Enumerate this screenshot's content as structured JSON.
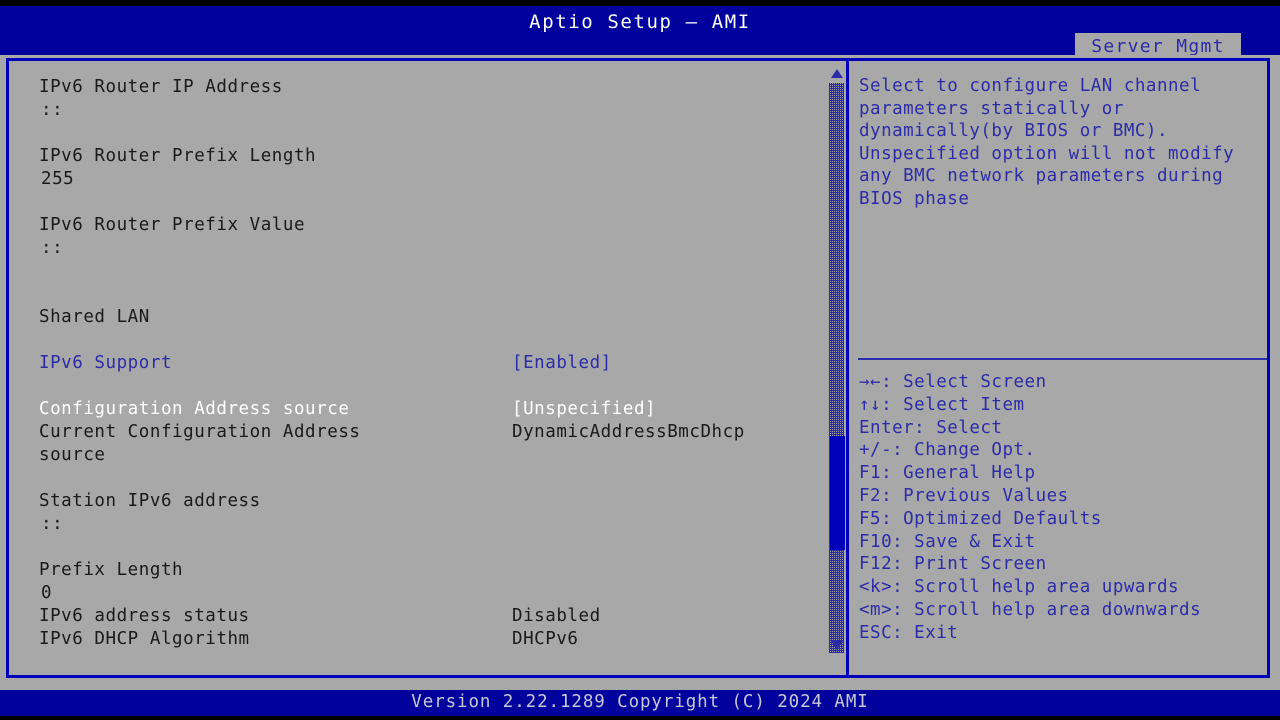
{
  "header": {
    "title": "Aptio Setup – AMI",
    "active_tab": "Server Mgmt"
  },
  "settings": {
    "rows": [
      {
        "label": "IPv6 Router IP Address",
        "value": "",
        "label_color": "dark",
        "value_color": "dark",
        "indent": false
      },
      {
        "label": "::",
        "value": "",
        "label_color": "dark",
        "value_color": "dark",
        "indent": true
      },
      {
        "label": "",
        "value": "",
        "label_color": "dark",
        "value_color": "dark",
        "indent": false
      },
      {
        "label": "IPv6 Router Prefix Length",
        "value": "",
        "label_color": "dark",
        "value_color": "dark",
        "indent": false
      },
      {
        "label": "255",
        "value": "",
        "label_color": "dark",
        "value_color": "dark",
        "indent": true
      },
      {
        "label": "",
        "value": "",
        "label_color": "dark",
        "value_color": "dark",
        "indent": false
      },
      {
        "label": "IPv6 Router Prefix Value",
        "value": "",
        "label_color": "dark",
        "value_color": "dark",
        "indent": false
      },
      {
        "label": "::",
        "value": "",
        "label_color": "dark",
        "value_color": "dark",
        "indent": true
      },
      {
        "label": "",
        "value": "",
        "label_color": "dark",
        "value_color": "dark",
        "indent": false
      },
      {
        "label": "",
        "value": "",
        "label_color": "dark",
        "value_color": "dark",
        "indent": false
      },
      {
        "label": "Shared LAN",
        "value": "",
        "label_color": "dark",
        "value_color": "dark",
        "indent": false
      },
      {
        "label": "",
        "value": "",
        "label_color": "dark",
        "value_color": "dark",
        "indent": false
      },
      {
        "label": "IPv6 Support",
        "value": "[Enabled]",
        "label_color": "blue",
        "value_color": "blue",
        "indent": false
      },
      {
        "label": "",
        "value": "",
        "label_color": "dark",
        "value_color": "dark",
        "indent": false
      },
      {
        "label": "Configuration Address source",
        "value": "[Unspecified]",
        "label_color": "white",
        "value_color": "white",
        "indent": false
      },
      {
        "label": "Current Configuration Address",
        "value": "DynamicAddressBmcDhcp",
        "label_color": "dark",
        "value_color": "dark",
        "indent": false
      },
      {
        "label": "source",
        "value": "",
        "label_color": "dark",
        "value_color": "dark",
        "indent": false
      },
      {
        "label": "",
        "value": "",
        "label_color": "dark",
        "value_color": "dark",
        "indent": false
      },
      {
        "label": "Station IPv6 address",
        "value": "",
        "label_color": "dark",
        "value_color": "dark",
        "indent": false
      },
      {
        "label": "::",
        "value": "",
        "label_color": "dark",
        "value_color": "dark",
        "indent": true
      },
      {
        "label": "",
        "value": "",
        "label_color": "dark",
        "value_color": "dark",
        "indent": false
      },
      {
        "label": "Prefix Length",
        "value": "",
        "label_color": "dark",
        "value_color": "dark",
        "indent": false
      },
      {
        "label": "0",
        "value": "",
        "label_color": "dark",
        "value_color": "dark",
        "indent": true
      },
      {
        "label": "IPv6 address status",
        "value": "Disabled",
        "label_color": "dark",
        "value_color": "dark",
        "indent": false
      },
      {
        "label": "IPv6 DHCP Algorithm",
        "value": "DHCPv6",
        "label_color": "dark",
        "value_color": "dark",
        "indent": false
      }
    ]
  },
  "scrollbar": {
    "up_arrow": "scroll-up-arrow",
    "down_arrow": "scroll-down-arrow",
    "thumb_top_pct": 62,
    "thumb_height_pct": 20
  },
  "help": {
    "description": "Select to configure LAN channel parameters statically or dynamically(by BIOS or BMC). Unspecified option will not modify any BMC network parameters during BIOS phase",
    "keys": [
      "→←: Select Screen",
      "↑↓: Select Item",
      "Enter: Select",
      "+/-: Change Opt.",
      "F1: General Help",
      "F2: Previous Values",
      "F5: Optimized Defaults",
      "F10: Save & Exit",
      "F12: Print Screen",
      "<k>: Scroll help area upwards",
      "<m>: Scroll help area downwards",
      "ESC: Exit"
    ]
  },
  "footer": {
    "version_text": "Version 2.22.1289 Copyright (C) 2024 AMI"
  },
  "colors": {
    "title_bar": "#00009c",
    "panel_border": "#0000bb",
    "panel_bg": "#a8a8a8",
    "text_dark": "#1a1a1a",
    "text_blue": "#2c2ca8",
    "text_selected": "#ffffff",
    "footer_text": "#c8c8d8"
  }
}
